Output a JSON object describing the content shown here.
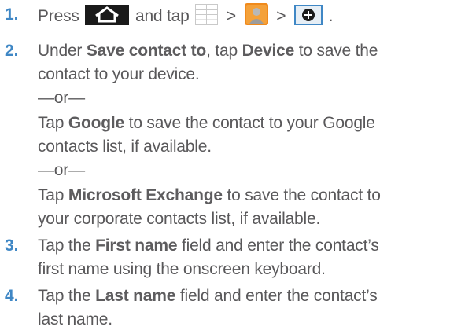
{
  "steps": [
    {
      "num": "1.",
      "t1": "Press",
      "t2": "and tap",
      "sep1": ">",
      "sep2": ">",
      "end": "."
    },
    {
      "num": "2.",
      "lines": [
        [
          "Under ",
          "Save contact to",
          ", tap ",
          "Device",
          " to save the"
        ],
        [
          "contact to your device."
        ],
        [
          "—or—"
        ],
        [
          "Tap ",
          "Google",
          " to save the contact to your Google"
        ],
        [
          "contacts list, if available."
        ],
        [
          "—or—"
        ],
        [
          "Tap ",
          "Microsoft Exchange",
          " to save the contact to"
        ],
        [
          "your corporate contacts list, if available."
        ]
      ]
    },
    {
      "num": "3.",
      "lines": [
        [
          "Tap the ",
          "First name",
          " field and enter the contact’s"
        ],
        [
          "first name using the onscreen keyboard."
        ]
      ]
    },
    {
      "num": "4.",
      "lines": [
        [
          "Tap the ",
          "Last name",
          " field and enter the contact’s"
        ],
        [
          "last name."
        ]
      ]
    }
  ],
  "icons": {
    "home": "home-icon",
    "apps": "apps-grid-icon",
    "contacts": "contacts-app-icon",
    "add": "add-contact-icon"
  },
  "colors": {
    "step_number": "#3f87c5",
    "text": "#59585a"
  }
}
